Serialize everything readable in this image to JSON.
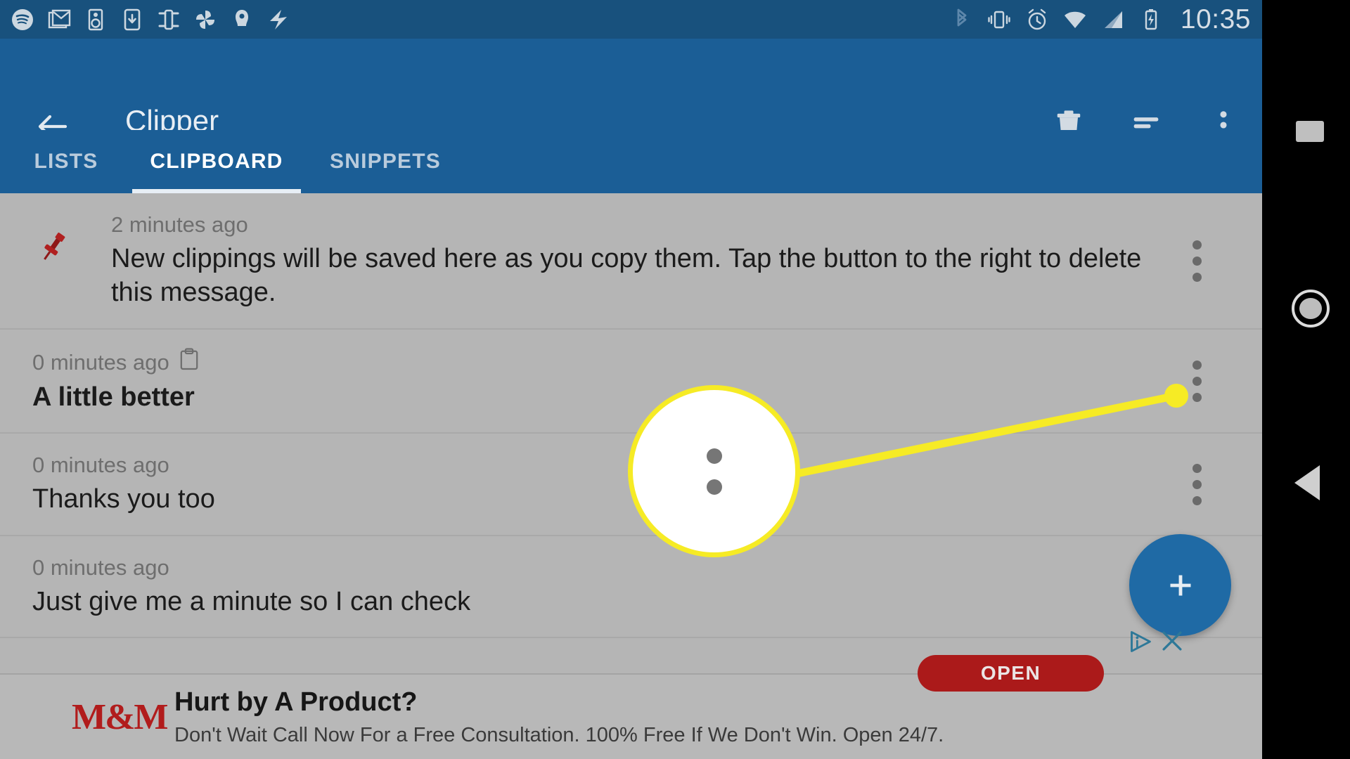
{
  "status_bar": {
    "time": "10:35",
    "left_icons": [
      "spotify-icon",
      "gmail-icon",
      "speaker-icon",
      "download-phone-icon",
      "cast-screen-icon",
      "pinwheel-icon",
      "keyhole-icon",
      "lightning-icon"
    ],
    "right_icons": [
      "bluetooth-icon",
      "vibrate-icon",
      "alarm-icon",
      "wifi-icon",
      "cell-signal-icon",
      "battery-charging-icon"
    ]
  },
  "app_bar": {
    "title": "Clipper",
    "back_icon": "back-arrow-icon",
    "actions": [
      {
        "name": "delete",
        "icon": "trash-icon"
      },
      {
        "name": "sort",
        "icon": "sort-icon"
      },
      {
        "name": "overflow",
        "icon": "overflow-menu-icon"
      }
    ]
  },
  "tabs": {
    "items": [
      {
        "label": "LISTS",
        "selected": false
      },
      {
        "label": "CLIPBOARD",
        "selected": true
      },
      {
        "label": "SNIPPETS",
        "selected": false
      }
    ]
  },
  "clipboard_list": [
    {
      "time": "2 minutes ago",
      "text": "New clippings will be saved here as you copy them. Tap the button to the right to delete this message.",
      "pinned": true,
      "bold": false,
      "badge_icon": null
    },
    {
      "time": "0 minutes ago",
      "text": "A little better",
      "pinned": false,
      "bold": true,
      "badge_icon": "clipboard-icon"
    },
    {
      "time": "0 minutes ago",
      "text": "Thanks you too",
      "pinned": false,
      "bold": false,
      "badge_icon": null
    },
    {
      "time": "0 minutes ago",
      "text": "Just give me a minute so I can check",
      "pinned": false,
      "bold": false,
      "badge_icon": null
    }
  ],
  "fab": {
    "icon": "plus-icon",
    "label": "+"
  },
  "callout": {
    "highlight_icon": "overflow-menu-icon",
    "line_color": "#f6eb25",
    "target_row_index": 1
  },
  "ad": {
    "logo_text": "M&M",
    "headline": "Hurt by A Product?",
    "description": "Don't Wait Call Now For a Free Consultation. 100% Free If We Don't Win. Open 24/7.",
    "cta_label": "OPEN",
    "adchoices_icon": "adchoices-icon",
    "close_icon": "close-icon"
  },
  "nav_bar": {
    "recents": "recents-square-icon",
    "home": "home-circle-icon",
    "back": "back-triangle-icon"
  },
  "colors": {
    "status_bar": "#18517d",
    "app_bar": "#1b5e96",
    "list_bg": "#b5b5b5",
    "fab": "#1f6aa5",
    "highlight": "#f6eb25",
    "ad_cta": "#ab1a1a",
    "pin": "#b02020"
  }
}
